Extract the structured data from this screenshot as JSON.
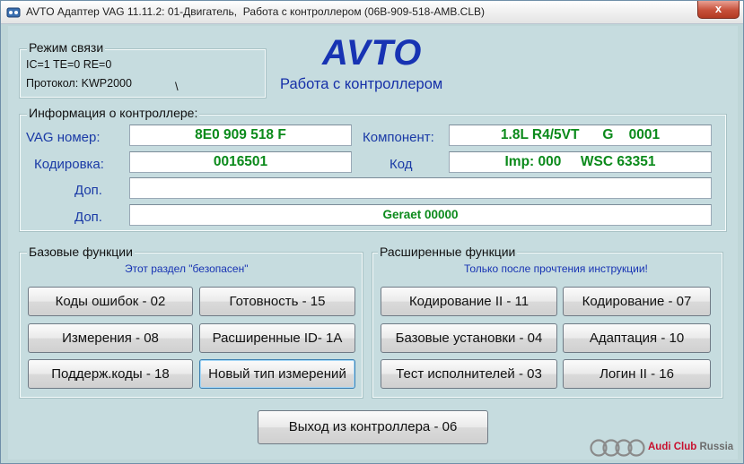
{
  "window": {
    "title": "AVTO Адаптер VAG 11.11.2: 01-Двигатель,  Работа с контроллером (06В-909-518-AMB.CLB)",
    "close_label": "x"
  },
  "connection": {
    "title": "Режим связи",
    "status": "IC=1  TE=0   RE=0",
    "protocol": "Протокол: KWP2000",
    "caret": "\\"
  },
  "header": {
    "logo": "AVTO",
    "subtitle": "Работа с контроллером"
  },
  "controller_info": {
    "title": "Информация о контроллере:",
    "vag_label": "VAG номер:",
    "vag_value": "8E0 909 518 F",
    "component_label": "Компонент:",
    "component_value": "1.8L R4/5VT      G    0001",
    "coding_label": "Кодировка:",
    "coding_value": "0016501",
    "code_label": "Код",
    "code_value": "Imp: 000     WSC 63351",
    "extra1_label": "Доп.",
    "extra1_value": "",
    "extra2_label": "Доп.",
    "extra2_value": "Geraet 00000"
  },
  "basic_functions": {
    "title": "Базовые функции",
    "note": "Этот раздел \"безопасен\"",
    "buttons": [
      "Коды ошибок - 02",
      "Готовность - 15",
      "Измерения - 08",
      "Расширенные ID- 1A",
      "Поддерж.коды - 18",
      "Новый тип измерений"
    ]
  },
  "advanced_functions": {
    "title": "Расширенные функции",
    "note": "Только после прочтения инструкции!",
    "buttons": [
      "Кодирование II - 11",
      "Кодирование - 07",
      "Базовые установки - 04",
      "Адаптация - 10",
      "Тест исполнителей - 03",
      "Логин II - 16"
    ]
  },
  "exit_button": "Выход из контроллера - 06",
  "brand": {
    "name_red": "Audi Club",
    "name_gray": " Russia"
  },
  "colors": {
    "background": "#c6dcdf",
    "accent_blue": "#1733b3",
    "value_green": "#0b8a1b",
    "brand_red": "#c8102e"
  }
}
